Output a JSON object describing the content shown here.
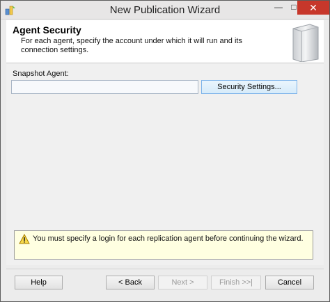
{
  "window": {
    "title": "New Publication Wizard",
    "minimize_glyph": "—",
    "maximize_glyph": "□",
    "close_glyph": "✕"
  },
  "header": {
    "title": "Agent Security",
    "description": "For each agent, specify the account under which it will run and its connection settings."
  },
  "snapshot_agent": {
    "label": "Snapshot Agent:",
    "value": "",
    "security_button_label": "Security Settings..."
  },
  "warning": {
    "icon": "warning-icon",
    "text": "You must specify a login for each replication agent before continuing the wizard."
  },
  "footer": {
    "help_label": "Help",
    "back_label": "< Back",
    "next_label": "Next >",
    "finish_label": "Finish >>|",
    "cancel_label": "Cancel"
  },
  "colors": {
    "close_button": "#c7372b",
    "warning_background": "#ffffe1",
    "primary_button_border": "#7eb4ea"
  }
}
